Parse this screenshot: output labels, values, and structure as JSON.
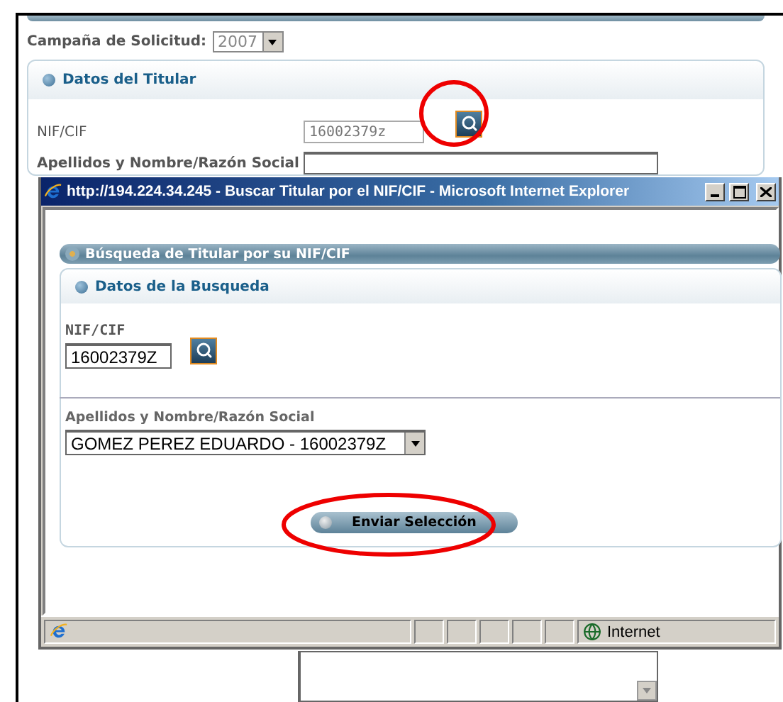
{
  "page": {
    "campaign": {
      "label": "Campaña de Solicitud:",
      "value": "2007"
    },
    "panel": {
      "title": "Datos del Titular",
      "nif": {
        "label": "NIF/CIF",
        "value": "16002379z"
      },
      "name": {
        "label": "Apellidos y Nombre/Razón Social"
      }
    }
  },
  "popup": {
    "title": "http://194.224.34.245 - Buscar Titular por el NIF/CIF - Microsoft Internet Explorer",
    "section_title": "Búsqueda de Titular por su NIF/CIF",
    "panel_title": "Datos de la Busqueda",
    "nif": {
      "label": "NIF/CIF",
      "value": "16002379Z"
    },
    "name": {
      "label": "Apellidos y Nombre/Razón Social",
      "value": "GOMEZ PEREZ EDUARDO - 16002379Z"
    },
    "button": "Enviar Selección",
    "status": {
      "zone": "Internet"
    }
  }
}
